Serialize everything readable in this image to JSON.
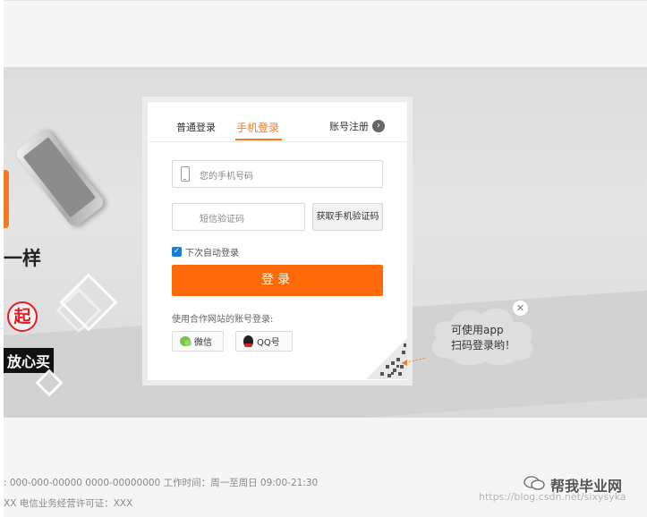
{
  "promo": {
    "line1": "一样",
    "circle_char": "起",
    "black_label": "放心买"
  },
  "login": {
    "tabs": {
      "normal": "普通登录",
      "phone": "手机登录",
      "register": "账号注册"
    },
    "phone_placeholder": "您的手机号码",
    "code_placeholder": "短信验证码",
    "get_code_label": "获取手机验证码",
    "remember_label": "下次自动登录",
    "login_button": "登录",
    "partner_label": "使用合作网站的账号登录:",
    "wechat_label": "微信",
    "qq_label": "QQ号"
  },
  "qr_tip": {
    "line1": "可使用app",
    "line2": "扫码登录哟！",
    "close": "✕"
  },
  "footer": {
    "line1": ": 000-000-00000  0000-00000000    工作时间：周一至周日 09:00-21:30",
    "line2": "XX    电信业务经营许可证：XXX"
  },
  "watermark": {
    "name": "帮我毕业网",
    "url": "https://blog.csdn.net/sixysyka"
  },
  "colors": {
    "accent": "#f47920",
    "login_button": "#fe6a0a",
    "checkbox": "#1e7bd6"
  }
}
